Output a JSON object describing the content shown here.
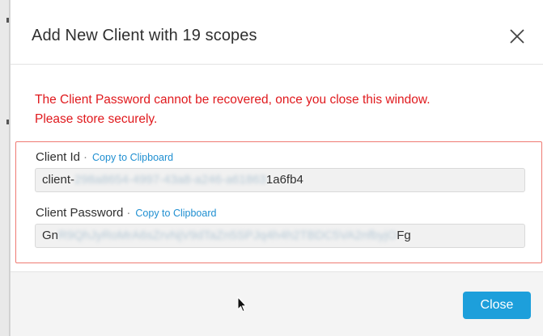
{
  "dialog": {
    "title": "Add New Client with 19 scopes",
    "close_icon": "close-icon",
    "warning_line1": "The Client Password cannot be recovered, once you close this window.",
    "warning_line2": "Please store securely.",
    "client_id": {
      "label": "Client Id",
      "separator": "·",
      "copy_label": "Copy to Clipboard",
      "value_prefix": "client-",
      "value_obscured": "298a8654-4997-43a8-a246-a61863",
      "value_suffix": "1a6fb4"
    },
    "client_password": {
      "label": "Client Password",
      "separator": "·",
      "copy_label": "Copy to Clipboard",
      "value_prefix": "Gn",
      "value_obscured": "R9QhJyRoMrA6sZrvNjV9dTaZn5SPJq4h4h2TBDC5VA2nfbyjO",
      "value_suffix": "Fg"
    },
    "close_button": "Close"
  },
  "colors": {
    "warning": "#e0191d",
    "highlight_border": "#ef7a72",
    "link": "#1f8fd1",
    "primary_button": "#1d9fdb"
  }
}
